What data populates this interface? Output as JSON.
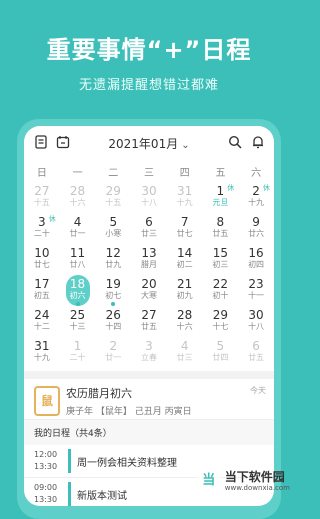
{
  "headline": "重要事情“+”日程",
  "subline": "无遗漏提醒想错过都难",
  "header": {
    "month": "2021年01月",
    "chevron": "⌄"
  },
  "weekdays": [
    "日",
    "一",
    "二",
    "三",
    "四",
    "五",
    "六"
  ],
  "days": [
    {
      "n": "27",
      "l": "十五",
      "dim": true
    },
    {
      "n": "28",
      "l": "十六",
      "dim": true
    },
    {
      "n": "29",
      "l": "十五",
      "dim": true
    },
    {
      "n": "30",
      "l": "十八",
      "dim": true
    },
    {
      "n": "31",
      "l": "十九",
      "dim": true
    },
    {
      "n": "1",
      "l": "元旦",
      "badge": "休",
      "hl": true
    },
    {
      "n": "2",
      "l": "十九",
      "badge": "休"
    },
    {
      "n": "3",
      "l": "二十",
      "badge": "休"
    },
    {
      "n": "4",
      "l": "廿一"
    },
    {
      "n": "5",
      "l": "小寒"
    },
    {
      "n": "6",
      "l": "廿三"
    },
    {
      "n": "7",
      "l": "廿七"
    },
    {
      "n": "8",
      "l": "廿五"
    },
    {
      "n": "9",
      "l": "廿六"
    },
    {
      "n": "10",
      "l": "廿七"
    },
    {
      "n": "11",
      "l": "廿八"
    },
    {
      "n": "12",
      "l": "廿九"
    },
    {
      "n": "13",
      "l": "腊月"
    },
    {
      "n": "14",
      "l": "初二"
    },
    {
      "n": "15",
      "l": "初三"
    },
    {
      "n": "16",
      "l": "初四"
    },
    {
      "n": "17",
      "l": "初五"
    },
    {
      "n": "18",
      "l": "初六",
      "sel": true,
      "dot": true
    },
    {
      "n": "19",
      "l": "初七",
      "dot": true
    },
    {
      "n": "20",
      "l": "大寒"
    },
    {
      "n": "21",
      "l": "初九"
    },
    {
      "n": "22",
      "l": "初十"
    },
    {
      "n": "23",
      "l": "十一"
    },
    {
      "n": "24",
      "l": "十二"
    },
    {
      "n": "25",
      "l": "十三"
    },
    {
      "n": "26",
      "l": "十四"
    },
    {
      "n": "27",
      "l": "廿五"
    },
    {
      "n": "28",
      "l": "十六"
    },
    {
      "n": "29",
      "l": "十七"
    },
    {
      "n": "30",
      "l": "十八"
    },
    {
      "n": "31",
      "l": "十九"
    },
    {
      "n": "1",
      "l": "二十",
      "dim": true
    },
    {
      "n": "2",
      "l": "廿一",
      "dim": true
    },
    {
      "n": "3",
      "l": "立春",
      "dim": true
    },
    {
      "n": "4",
      "l": "廿三",
      "dim": true
    },
    {
      "n": "5",
      "l": "廿四",
      "dim": true
    },
    {
      "n": "6",
      "l": "廿五",
      "dim": true
    }
  ],
  "lunar": {
    "seal": "鼠",
    "title": "农历腊月初六",
    "sub": "庚子年 【鼠年】 己丑月 丙寅日",
    "today": "今天"
  },
  "schedule": {
    "heading": "我的日程（共4条）",
    "events": [
      {
        "start": "12:00",
        "end": "13:30",
        "title": "周一例会相关资料整理"
      },
      {
        "start": "09:00",
        "end": "13:30",
        "title": "新版本测试"
      }
    ]
  },
  "watermark": {
    "logo": "当",
    "name": "当下软件园",
    "url": "www.downxia.com"
  }
}
